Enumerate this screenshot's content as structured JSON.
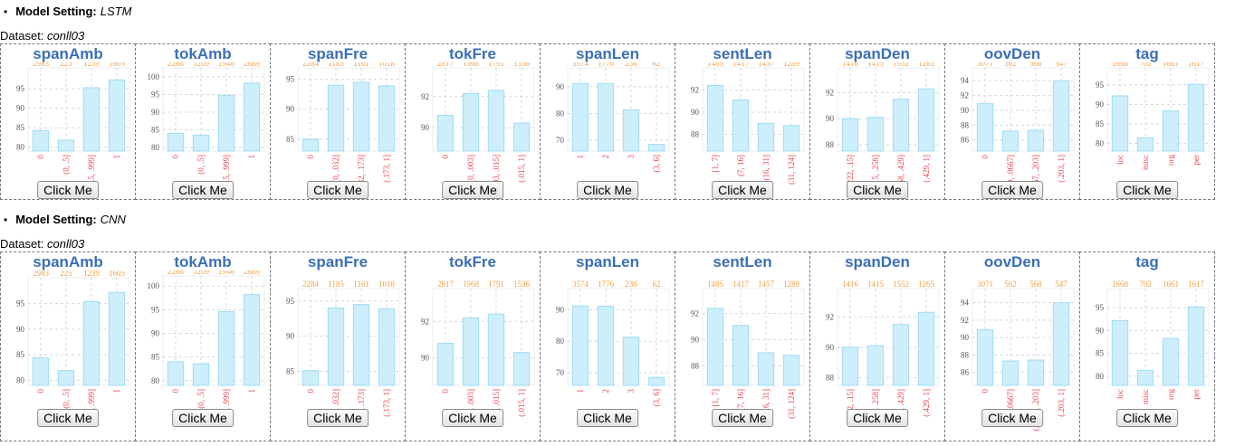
{
  "sections": [
    {
      "setting_label": "Model Setting:",
      "model": "LSTM",
      "dataset_label": "Dataset:",
      "dataset": "conll03",
      "button_label": "Click Me",
      "charts": [
        {
          "title": "spanAmb",
          "type": "bar",
          "ylim": [
            79,
            99
          ],
          "yticks": [
            80,
            85,
            90,
            95
          ],
          "categories": [
            "0",
            "(0, .5]",
            "(.5, .999]",
            "1"
          ],
          "values": [
            84.3,
            81.8,
            95.3,
            97.3
          ],
          "counts": [
            "2983",
            "225",
            "1239",
            "1605"
          ]
        },
        {
          "title": "tokAmb",
          "type": "bar",
          "ylim": [
            79,
            101
          ],
          "yticks": [
            80,
            85,
            90,
            95,
            100
          ],
          "categories": [
            "0",
            "(0, .5]",
            "(.5, .999]",
            "1"
          ],
          "values": [
            84,
            83.5,
            94.7,
            98.2
          ],
          "counts": [
            "2268",
            "1209",
            "1946",
            "2689"
          ]
        },
        {
          "title": "spanFre",
          "type": "bar",
          "ylim": [
            83,
            96
          ],
          "yticks": [
            85,
            90,
            95
          ],
          "categories": [
            "0",
            "(0, .032]",
            "(.032, .173]",
            "(.173, 1]"
          ],
          "values": [
            85,
            94,
            94.5,
            93.9
          ],
          "counts": [
            "2284",
            "1185",
            "1161",
            "1018"
          ]
        },
        {
          "title": "tokFre",
          "type": "bar",
          "ylim": [
            88.5,
            93.5
          ],
          "yticks": [
            90,
            92
          ],
          "categories": [
            "0",
            "(0, .003]",
            "(.003, .015]",
            "(.015, 1]"
          ],
          "values": [
            90.8,
            92.2,
            92.4,
            90.3
          ],
          "counts": [
            "2817",
            "1968",
            "1791",
            "1536"
          ]
        },
        {
          "title": "spanLen",
          "type": "bar",
          "ylim": [
            66,
            95
          ],
          "yticks": [
            70,
            80,
            90
          ],
          "categories": [
            "1",
            "2",
            "3",
            "(3, 6]"
          ],
          "values": [
            91.2,
            91.2,
            81.4,
            68.5
          ],
          "counts": [
            "3574",
            "1776",
            "236",
            "62"
          ]
        },
        {
          "title": "sentLen",
          "type": "bar",
          "ylim": [
            86.5,
            93.5
          ],
          "yticks": [
            88,
            90,
            92
          ],
          "categories": [
            "[1, 7]",
            "(7, 16]",
            "(16, 31]",
            "(31, 124]"
          ],
          "values": [
            92.4,
            91.1,
            89,
            88.8
          ],
          "counts": [
            "1485",
            "1417",
            "1457",
            "1289"
          ]
        },
        {
          "title": "spanDen",
          "type": "bar",
          "ylim": [
            87.5,
            93.5
          ],
          "yticks": [
            88,
            90,
            92
          ],
          "categories": [
            "[0222, .15]",
            "(.15, .258]",
            "(.258, .429]",
            "(.429, 1]"
          ],
          "values": [
            90,
            90.1,
            91.5,
            92.3
          ],
          "counts": [
            "1416",
            "1415",
            "1552",
            "1265"
          ]
        },
        {
          "title": "oovDen",
          "type": "bar",
          "ylim": [
            84.5,
            95
          ],
          "yticks": [
            86,
            88,
            90,
            92,
            94
          ],
          "categories": [
            "0",
            "(0, .0667]",
            "(.0667, .203]",
            "(.203, 1]"
          ],
          "values": [
            90.9,
            87.2,
            87.3,
            94
          ],
          "counts": [
            "3071",
            "562",
            "568",
            "547"
          ]
        },
        {
          "title": "tag",
          "type": "bar",
          "ylim": [
            78,
            98
          ],
          "yticks": [
            80,
            85,
            90,
            95
          ],
          "categories": [
            "loc",
            "misc",
            "org",
            "per"
          ],
          "values": [
            92.2,
            81.4,
            88.3,
            95.2
          ],
          "counts": [
            "1668",
            "702",
            "1661",
            "1617"
          ]
        }
      ]
    },
    {
      "setting_label": "Model Setting:",
      "model": "CNN",
      "dataset_label": "Dataset:",
      "dataset": "conll03",
      "button_label": "Click Me",
      "charts": [
        {
          "title": "spanAmb",
          "type": "bar",
          "ylim": [
            79,
            99
          ],
          "yticks": [
            80,
            85,
            90,
            95
          ],
          "categories": [
            "0",
            "(0, .5]",
            "(.5, .999]",
            "1"
          ],
          "values": [
            84.4,
            81.9,
            95.4,
            97.2
          ],
          "counts": [
            "2983",
            "225",
            "1239",
            "1605"
          ]
        },
        {
          "title": "tokAmb",
          "type": "bar",
          "ylim": [
            79,
            101
          ],
          "yticks": [
            80,
            85,
            90,
            95,
            100
          ],
          "categories": [
            "0",
            "(0, .5]",
            "(.5, .999]",
            "1"
          ],
          "values": [
            84,
            83.6,
            94.6,
            98.2
          ],
          "counts": [
            "2268",
            "1209",
            "1946",
            "2689"
          ]
        },
        {
          "title": "spanFre",
          "type": "bar",
          "ylim": [
            83,
            96
          ],
          "yticks": [
            85,
            90,
            95
          ],
          "categories": [
            "0",
            "(0, .032]",
            "(.032, .173]",
            "(.173, 1]"
          ],
          "values": [
            85.1,
            94,
            94.5,
            93.9
          ],
          "counts": [
            "2284",
            "1185",
            "1161",
            "1018"
          ]
        },
        {
          "title": "tokFre",
          "type": "bar",
          "ylim": [
            88.5,
            93.5
          ],
          "yticks": [
            90,
            92
          ],
          "categories": [
            "0",
            "(0, .003]",
            "(.003, .015]",
            "(.015, 1]"
          ],
          "values": [
            90.8,
            92.2,
            92.4,
            90.3
          ],
          "counts": [
            "2817",
            "1968",
            "1791",
            "1536"
          ]
        },
        {
          "title": "spanLen",
          "type": "bar",
          "ylim": [
            66,
            95
          ],
          "yticks": [
            70,
            80,
            90
          ],
          "categories": [
            "1",
            "2",
            "3",
            "(3, 6]"
          ],
          "values": [
            91.2,
            91.1,
            81.3,
            68.5
          ],
          "counts": [
            "3574",
            "1776",
            "236",
            "62"
          ]
        },
        {
          "title": "sentLen",
          "type": "bar",
          "ylim": [
            86.5,
            93.5
          ],
          "yticks": [
            88,
            90,
            92
          ],
          "categories": [
            "[1, 7]",
            "(7, 16]",
            "(16, 31]",
            "(31, 124]"
          ],
          "values": [
            92.4,
            91.1,
            89,
            88.8
          ],
          "counts": [
            "1485",
            "1417",
            "1457",
            "1289"
          ]
        },
        {
          "title": "spanDen",
          "type": "bar",
          "ylim": [
            87.5,
            93.5
          ],
          "yticks": [
            88,
            90,
            92
          ],
          "categories": [
            "[0222, .15]",
            "(.15, .258]",
            "(.258, .429]",
            "(.429, 1]"
          ],
          "values": [
            90,
            90.1,
            91.5,
            92.3
          ],
          "counts": [
            "1416",
            "1415",
            "1552",
            "1265"
          ]
        },
        {
          "title": "oovDen",
          "type": "bar",
          "ylim": [
            84.5,
            95
          ],
          "yticks": [
            86,
            88,
            90,
            92,
            94
          ],
          "categories": [
            "0",
            "(0, .0667]",
            "(.0667, .203]",
            "(.203, 1]"
          ],
          "values": [
            90.9,
            87.3,
            87.4,
            94
          ],
          "counts": [
            "3071",
            "562",
            "568",
            "547"
          ]
        },
        {
          "title": "tag",
          "type": "bar",
          "ylim": [
            78,
            98
          ],
          "yticks": [
            80,
            85,
            90,
            95
          ],
          "categories": [
            "loc",
            "misc",
            "org",
            "per"
          ],
          "values": [
            92.2,
            81.3,
            88.3,
            95.2
          ],
          "counts": [
            "1668",
            "702",
            "1661",
            "1617"
          ]
        }
      ]
    }
  ],
  "colors": {
    "bar_fill": "#cdeefb",
    "bar_stroke": "#9fdcf5",
    "count_text": "#f0a24a",
    "category_text": "#e8454f",
    "title": "#3b6fb6",
    "grid": "#d8d8d8"
  }
}
